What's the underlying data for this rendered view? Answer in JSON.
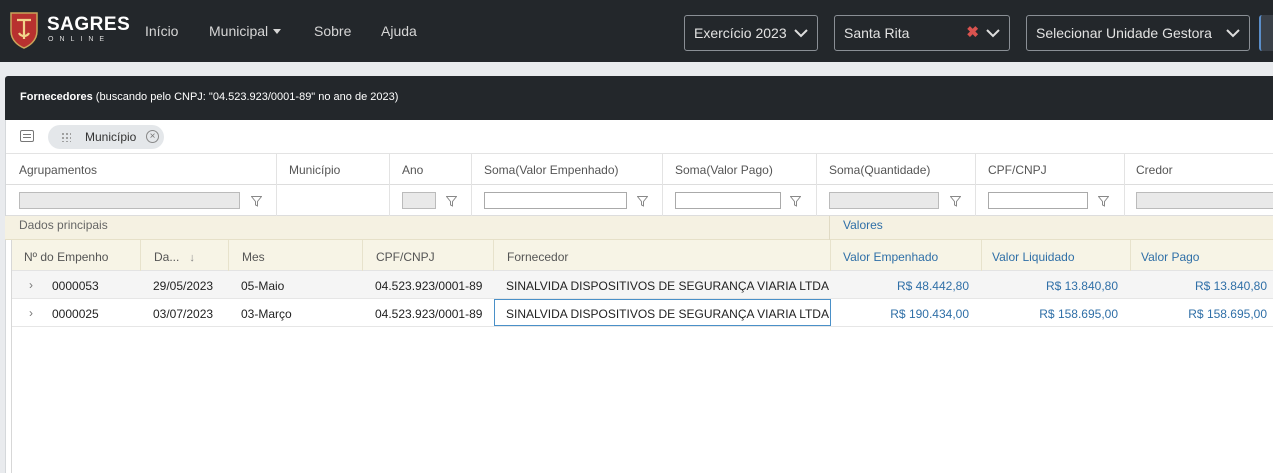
{
  "navbar": {
    "brand": "SAGRES",
    "brand_sub": "ONLINE",
    "links": [
      {
        "label": "Início",
        "dropdown": false
      },
      {
        "label": "Municipal",
        "dropdown": true
      },
      {
        "label": "Sobre",
        "dropdown": false
      },
      {
        "label": "Ajuda",
        "dropdown": false
      }
    ],
    "year_select": {
      "value": "Exercício  2023"
    },
    "municipality_select": {
      "value": "Santa Rita",
      "clearable": true
    },
    "unit_select": {
      "value": "Selecionar Unidade Gestora"
    }
  },
  "panel": {
    "title_bold": "Fornecedores",
    "title_rest": " (buscando pelo CNPJ: \"04.523.923/0001-89\" no ano de 2023)"
  },
  "group_bar": {
    "chip_label": "Município"
  },
  "pivot_headers": [
    "Agrupamentos",
    "Município",
    "Ano",
    "Soma(Valor Empenhado)",
    "Soma(Valor Pago)",
    "Soma(Quantidade)",
    "CPF/CNPJ",
    "Credor"
  ],
  "bands": {
    "main": "Dados principais",
    "values": "Valores"
  },
  "columns": [
    "Nº do Empenho",
    "Da...",
    "Mes",
    "CPF/CNPJ",
    "Fornecedor",
    "Valor Empenhado",
    "Valor Liquidado",
    "Valor Pago"
  ],
  "sort_indicator": "↓",
  "rows": [
    {
      "empenho": "0000053",
      "data": "29/05/2023",
      "mes": "05-Maio",
      "cnpj": "04.523.923/0001-89",
      "fornecedor": "SINALVIDA DISPOSITIVOS DE SEGURANÇA VIARIA LTDA",
      "valor_empenhado": "R$ 48.442,80",
      "valor_liquidado": "R$ 13.840,80",
      "valor_pago": "R$ 13.840,80"
    },
    {
      "empenho": "0000025",
      "data": "03/07/2023",
      "mes": "03-Março",
      "cnpj": "04.523.923/0001-89",
      "fornecedor": "SINALVIDA DISPOSITIVOS DE SEGURANÇA VIARIA LTDA",
      "valor_empenhado": "R$ 190.434,00",
      "valor_liquidado": "R$ 158.695,00",
      "valor_pago": "R$ 158.695,00"
    }
  ],
  "colors": {
    "navbar_bg": "#23272b",
    "accent_blue": "#2f6fa7",
    "band_bg": "#f5f1e2",
    "clear_red": "#d9534f"
  }
}
